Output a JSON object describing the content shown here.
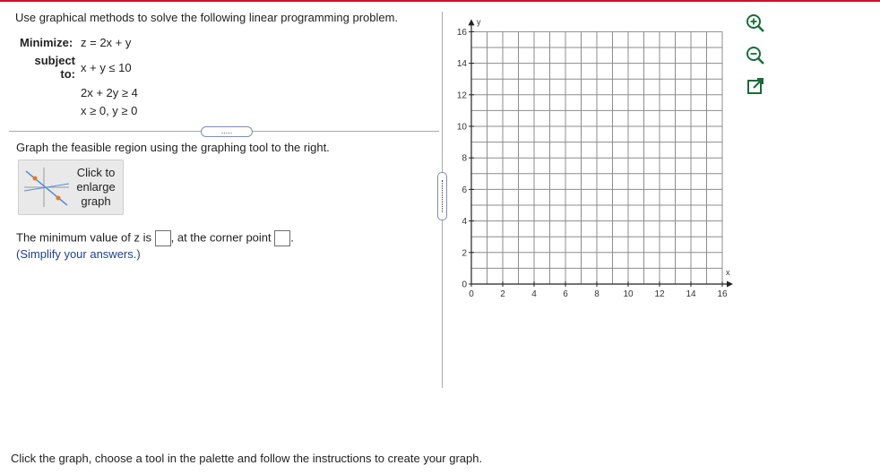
{
  "question": {
    "title": "Use graphical methods to solve the following linear programming problem.",
    "minimize_label": "Minimize:",
    "objective": "z = 2x + y",
    "subject_label": "subject to:",
    "constraints": [
      "x + y ≤ 10",
      "2x + 2y ≥ 4",
      "x ≥ 0, y ≥ 0"
    ],
    "more_label": "....."
  },
  "instruction": "Graph the feasible region using the graphing tool to the right.",
  "enlarge_button": {
    "label": "Click to enlarge graph"
  },
  "answer": {
    "min_text": "The minimum value of z is",
    "corner_text": ", at the corner point",
    "end_text": ".",
    "hint": "(Simplify your answers.)"
  },
  "graph": {
    "x_axis_label": "x",
    "y_axis_label": "y",
    "x_ticks": [
      0,
      2,
      4,
      6,
      8,
      10,
      12,
      14,
      16
    ],
    "y_ticks": [
      0,
      2,
      4,
      6,
      8,
      10,
      12,
      14,
      16
    ],
    "x_range": [
      0,
      16
    ],
    "y_range": [
      0,
      16
    ],
    "grid_step": 1,
    "grid": true
  },
  "tools": [
    "zoom-in-icon",
    "zoom-out-icon",
    "external-window-icon"
  ],
  "colors": {
    "accent_bar": "#c8102e",
    "hint_text": "#1f3f8f"
  },
  "footer": "Click the graph, choose a tool in the palette and follow the instructions to create your graph."
}
